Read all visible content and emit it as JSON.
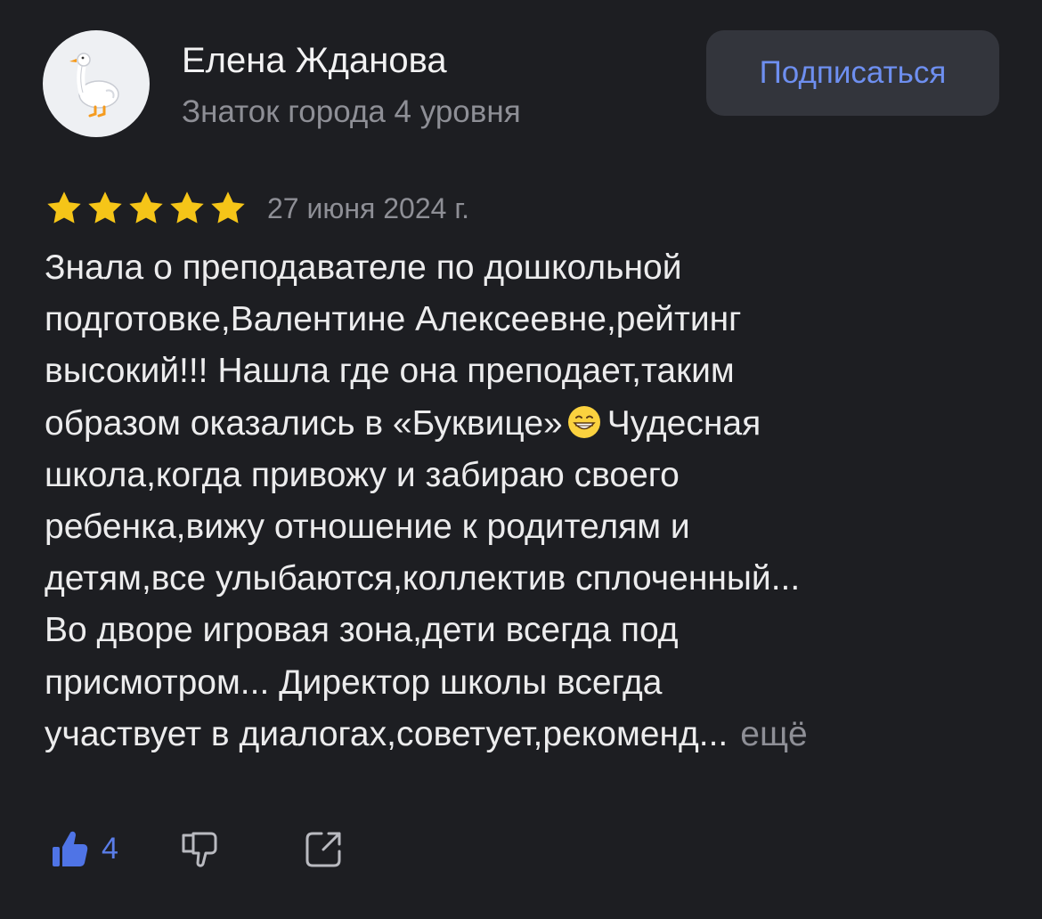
{
  "author": {
    "name": "Елена Жданова",
    "level": "Знаток города 4 уровня",
    "avatar_icon": "goose-icon"
  },
  "subscribe_label": "Подписаться",
  "review": {
    "rating": 5,
    "rating_max": 5,
    "date": "27 июня 2024 г.",
    "lines": [
      "Знала о преподавателе по дошкольной",
      "подготовке,Валентине Алексеевне,рейтинг",
      "высокий!!! Нашла где она преподает,таким",
      "образом оказались в «Буквице»",
      "Чудесная",
      "школа,когда привожу и забираю своего",
      "ребенка,вижу отношение к родителям и",
      "детям,все улыбаются,коллектив сплоченный...",
      "Во дворе игровая зона,дети всегда под",
      "присмотром... Директор школы всегда",
      "участвует в диалогах,советует,рекоменд..."
    ],
    "more_label": "ещё",
    "emoji": "grinning-face-emoji"
  },
  "actions": {
    "like_count": "4",
    "like_icon": "thumbs-up-icon",
    "dislike_icon": "thumbs-down-icon",
    "share_icon": "share-icon"
  },
  "colors": {
    "background": "#1d1e22",
    "accent": "#5a7de8",
    "star": "#f5c518",
    "muted": "#8e8f96"
  }
}
